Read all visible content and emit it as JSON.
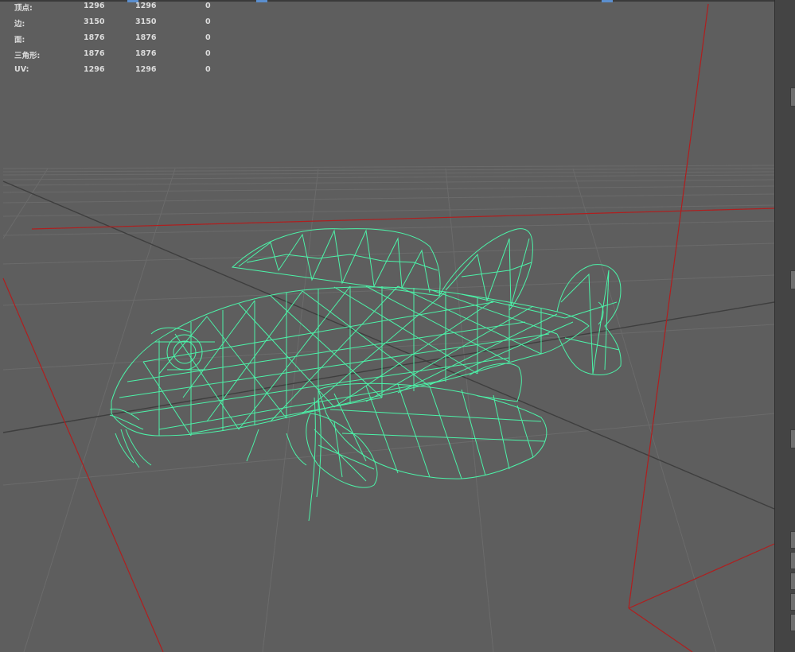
{
  "heads_up_display": {
    "poly_count": [
      {
        "label": "顶点:",
        "v1": "1296",
        "v2": "1296",
        "v3": "0"
      },
      {
        "label": "边:",
        "v1": "3150",
        "v2": "3150",
        "v3": "0"
      },
      {
        "label": "面:",
        "v1": "1876",
        "v2": "1876",
        "v3": "0"
      },
      {
        "label": "三角形:",
        "v1": "1876",
        "v2": "1876",
        "v3": "0"
      },
      {
        "label": "UV:",
        "v1": "1296",
        "v2": "1296",
        "v3": "0"
      }
    ]
  },
  "colors": {
    "viewport_bg": "#5e5e5e",
    "grid_line": "#6b6b6b",
    "axis_dark": "#3c3c3c",
    "axis_red": "#b82020",
    "wireframe": "#4cf2a8"
  },
  "viewport": {
    "mode": "wireframe",
    "model": "fish-mesh"
  }
}
